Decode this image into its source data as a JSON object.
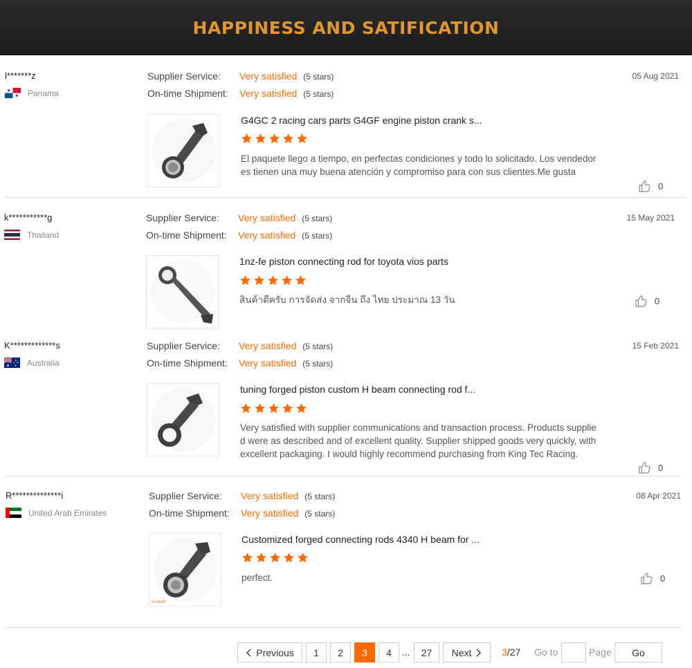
{
  "banner": {
    "title": "HAPPINESS AND SATIFICATION"
  },
  "labels": {
    "supplier_service": "Supplier Service:",
    "ontime_shipment": "On-time Shipment:"
  },
  "colors": {
    "accent": "#ff6a00",
    "banner_text": "#e3962b",
    "banner_bg": "#1c1c1c"
  },
  "reviews": [
    {
      "user": "l*******z",
      "country": "Panama",
      "flag": "panama-flag",
      "supplier_rating": "Very satisfied",
      "supplier_stars": "(5 stars)",
      "shipment_rating": "Very satisfied",
      "shipment_stars": "(5 stars)",
      "date": "05 Aug 2021",
      "product_title": "G4GC 2 racing cars parts G4GF engine piston crank s...",
      "rating": 5,
      "comment": "El paquete llego a tiempo, en perfectas condiciones y todo lo solicitado. Los vendedores tienen una muy buena atención y compromiso para con sus clientes.Me gusta",
      "likes": "0",
      "image_caption": ""
    },
    {
      "user": "k***********g",
      "country": "Thailand",
      "flag": "thailand-flag",
      "supplier_rating": "Very satisfied",
      "supplier_stars": "(5 stars)",
      "shipment_rating": "Very satisfied",
      "shipment_stars": "(5 stars)",
      "date": "15 May 2021",
      "product_title": "1nz-fe piston connecting rod for toyota vios parts",
      "rating": 5,
      "comment": "สินค้าดีครับ การจัดส่ง จากจีน ถึง ไทย ประมาณ 13 วัน",
      "likes": "0",
      "image_caption": ""
    },
    {
      "user": "K*************s",
      "country": "Australia",
      "flag": "australia-flag",
      "supplier_rating": "Very satisfied",
      "supplier_stars": "(5 stars)",
      "shipment_rating": "Very satisfied",
      "shipment_stars": "(5 stars)",
      "date": "15 Feb 2021",
      "product_title": "tuning forged piston custom H beam connecting rod f...",
      "rating": 5,
      "comment": "Very satisfied with supplier communications and transaction process. Products supplied were as described and of excellent quality. Supplier shipped goods very quickly, with excellent packaging. I would highly recommend purchasing from King Tec Racing.",
      "likes": "0",
      "image_caption": ""
    },
    {
      "user": "R**************i",
      "country": "United Arab Emirates",
      "flag": "uae-flag",
      "supplier_rating": "Very satisfied",
      "supplier_stars": "(5 stars)",
      "shipment_rating": "Very satisfied",
      "shipment_stars": "(5 stars)",
      "date": "08 Apr 2021",
      "product_title": "Customized forged connecting rods 4340 H beam for ...",
      "rating": 5,
      "comment": "perfect.",
      "likes": "0",
      "image_caption": "Custom"
    }
  ],
  "pagination": {
    "previous": "Previous",
    "pages": [
      "1",
      "2",
      "3",
      "4"
    ],
    "ellipsis": "...",
    "last_page": "27",
    "next": "Next",
    "current_page": "3",
    "current": "3",
    "total_label": "/27",
    "goto_label": "Go to",
    "goto_value": "",
    "page_label": "Page",
    "go_button": "Go"
  }
}
